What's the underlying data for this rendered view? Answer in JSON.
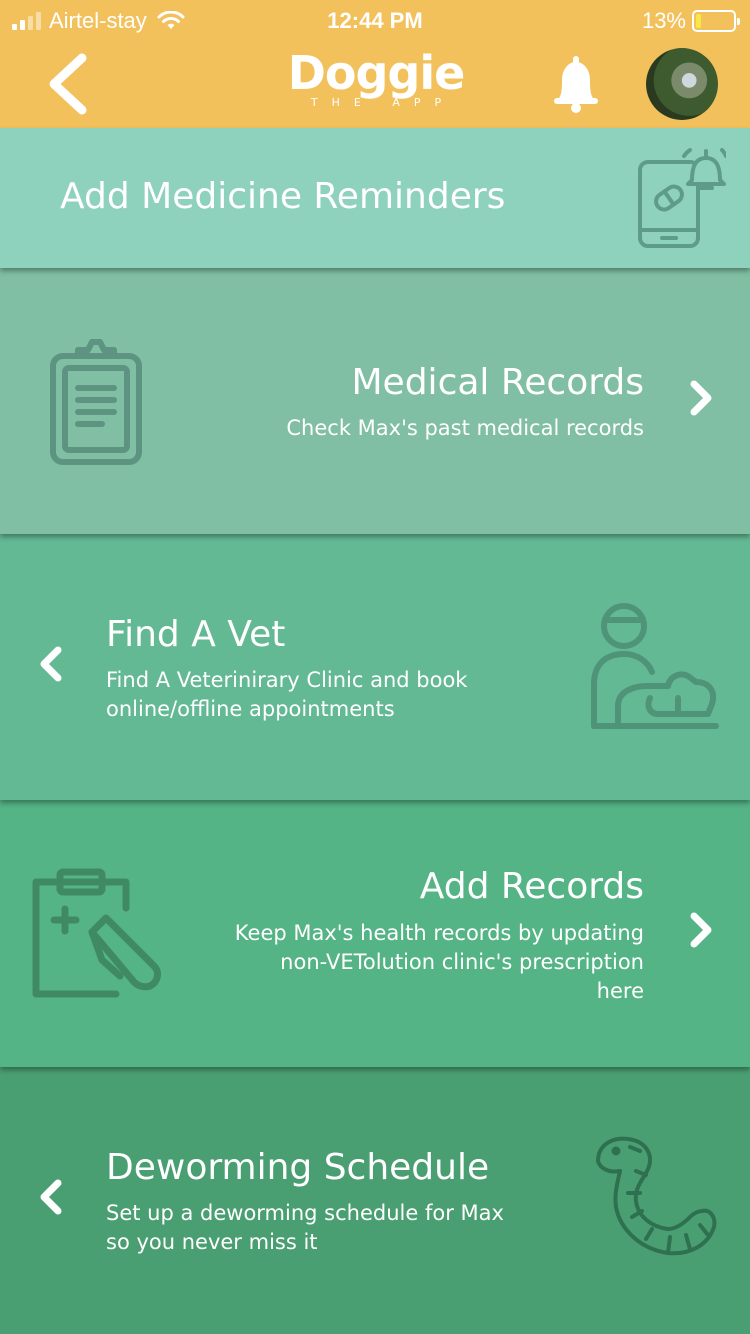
{
  "status_bar": {
    "carrier": "Airtel-stay",
    "time": "12:44 PM",
    "battery_percent": "13%",
    "battery_level": 0.13
  },
  "header": {
    "logo_word": "Doggie",
    "logo_sub": "THE APP",
    "brand_color": "#f3c15c"
  },
  "cards": {
    "medicine": {
      "title": "Add Medicine Reminders"
    },
    "medical_records": {
      "title": "Medical Records",
      "subtitle": "Check Max's past medical records"
    },
    "find_vet": {
      "title": "Find A Vet",
      "subtitle_line1": "Find A Veterinirary Clinic and book",
      "subtitle_line2": "online/offline appointments"
    },
    "add_records": {
      "title": "Add Records",
      "subtitle_line1": "Keep Max's health records by updating",
      "subtitle_line2": "non-VETolution clinic's prescription",
      "subtitle_line3": "here"
    },
    "deworming": {
      "title": "Deworming Schedule",
      "subtitle_line1": "Set up a deworming schedule for Max",
      "subtitle_line2": "so you never miss it"
    }
  },
  "icons": {
    "back": "chevron-left-icon",
    "notifications": "bell-icon",
    "medicine": "phone-pill-alarm-icon",
    "records": "clipboard-icon",
    "vet": "vet-with-dog-icon",
    "add_records": "clipboard-pen-icon",
    "worm": "worm-icon"
  }
}
